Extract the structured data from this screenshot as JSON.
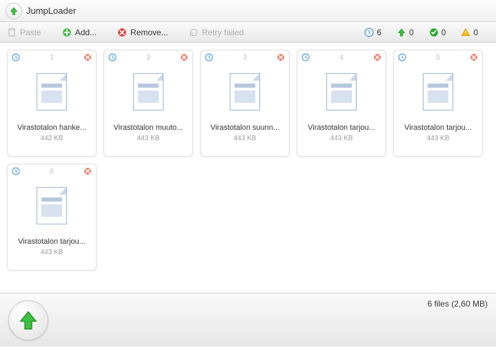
{
  "header": {
    "title": "JumpLoader"
  },
  "toolbar": {
    "paste": "Paste",
    "add": "Add...",
    "remove": "Remove...",
    "retry": "Retry failed"
  },
  "status": {
    "pending": "6",
    "uploaded": "0",
    "ok": "0",
    "warning": "0"
  },
  "files": [
    {
      "index": "1",
      "name": "Virastotalon hanke...",
      "size": "442 KB"
    },
    {
      "index": "2",
      "name": "Virastotalon muuto...",
      "size": "443 KB"
    },
    {
      "index": "3",
      "name": "Virastotalon suunn...",
      "size": "443 KB"
    },
    {
      "index": "4",
      "name": "Virastotalon tarjou...",
      "size": "443 KB"
    },
    {
      "index": "5",
      "name": "Virastotalon tarjou...",
      "size": "443 KB"
    },
    {
      "index": "6",
      "name": "Virastotalon tarjou...",
      "size": "443 KB"
    }
  ],
  "footer": {
    "summary": "6 files (2,60 MB)"
  }
}
